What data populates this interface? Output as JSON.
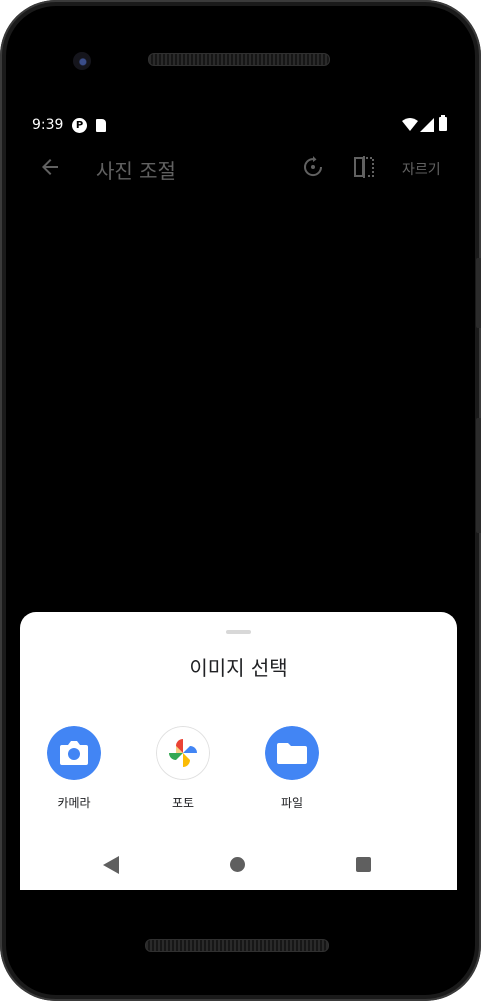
{
  "status_bar": {
    "time": "9:39",
    "notification_icons": [
      "app-notification-icon",
      "sd-card-icon"
    ],
    "system_icons": [
      "wifi-icon",
      "signal-icon",
      "battery-icon"
    ]
  },
  "app_bar": {
    "title": "사진 조절",
    "crop_label": "자르기"
  },
  "sheet": {
    "title": "이미지 선택",
    "options": [
      {
        "label": "카메라",
        "icon": "camera-icon",
        "color": "#4285F4"
      },
      {
        "label": "포토",
        "icon": "google-photos-icon",
        "color": "#FFFFFF"
      },
      {
        "label": "파일",
        "icon": "folder-icon",
        "color": "#4285F4"
      }
    ]
  },
  "navigation_bar": {
    "buttons": [
      "nav-back",
      "nav-home",
      "nav-recents"
    ]
  }
}
